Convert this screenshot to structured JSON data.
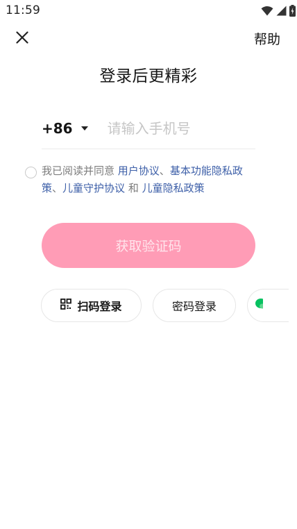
{
  "status_bar": {
    "time": "11:59"
  },
  "header": {
    "help_label": "帮助",
    "title": "登录后更精彩"
  },
  "phone_form": {
    "country_code": "+86",
    "placeholder": "请输入手机号",
    "value": ""
  },
  "agreement": {
    "prefix": "我已阅读并同意 ",
    "link_user_agreement": "用户协议",
    "sep1": "、",
    "link_privacy_basic": "基本功能隐私政策",
    "sep2": "、",
    "link_child_protection": "儿童守护协议",
    "sep3": " 和 ",
    "link_child_privacy": "儿童隐私政策",
    "checked": false
  },
  "submit": {
    "label": "获取验证码",
    "color": "#ff9cb6",
    "enabled": false
  },
  "alt_logins": {
    "qr_label": "扫码登录",
    "password_label": "密码登录",
    "more_icon": "wechat-icon"
  },
  "colors": {
    "link": "#3d5fa8",
    "accent": "#ff9cb6",
    "wechat_green": "#07c160"
  }
}
